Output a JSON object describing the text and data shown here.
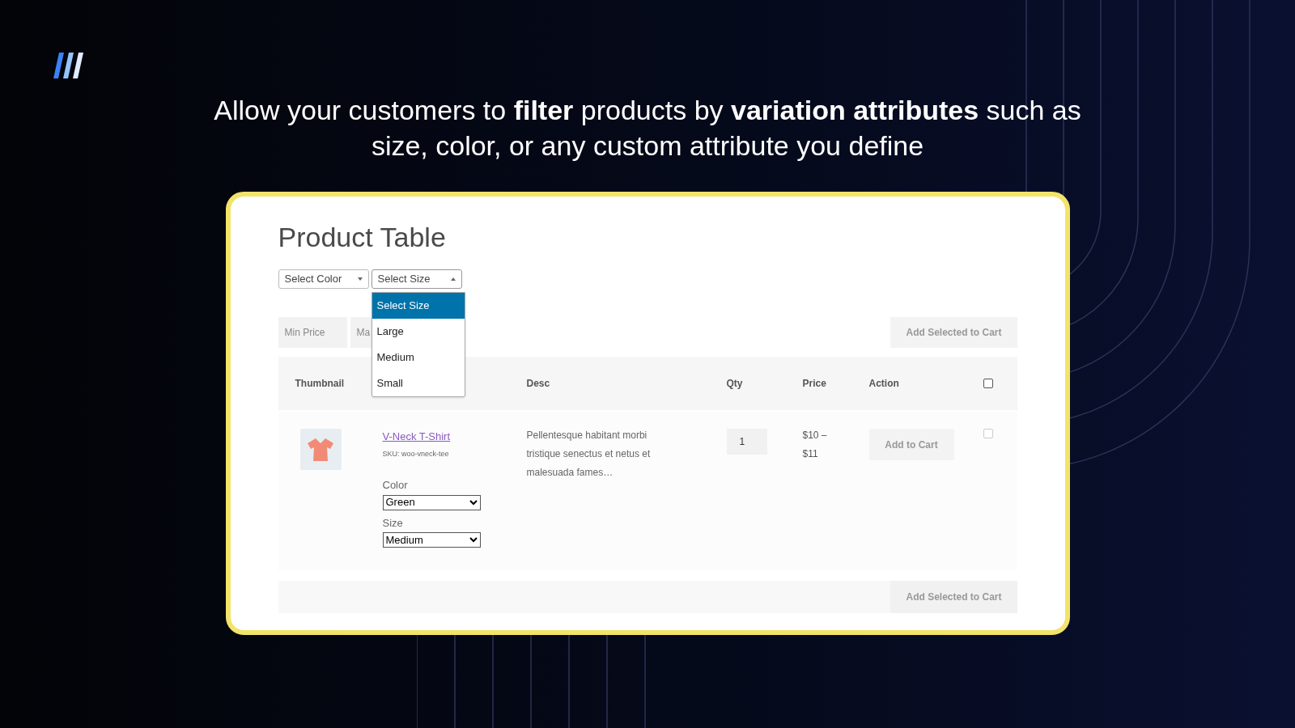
{
  "headline": "Allow your customers to **filter** products by **variation attributes** such as size, color, or any custom attribute you define",
  "page": {
    "title": "Product Table",
    "filters": [
      {
        "placeholder": "Select Color",
        "open": false
      },
      {
        "placeholder": "Select Size",
        "open": true
      }
    ],
    "size_options": [
      {
        "label": "Select Size",
        "selected": true
      },
      {
        "label": "Large",
        "selected": false
      },
      {
        "label": "Medium",
        "selected": false
      },
      {
        "label": "Small",
        "selected": false
      }
    ],
    "price_fields": [
      {
        "placeholder": "Min Price"
      },
      {
        "placeholder": "Ma"
      }
    ],
    "add_selected_top": "Add Selected to Cart",
    "table": {
      "columns": [
        "Thumbnail",
        "Desc",
        "Qty",
        "Price",
        "Action"
      ],
      "select_all_checked": false,
      "rows": [
        {
          "name": "V-Neck T-Shirt",
          "sku": "SKU: woo-vneck-tee",
          "attributes": [
            {
              "label": "Color",
              "value": "Green"
            },
            {
              "label": "Size",
              "value": "Medium"
            }
          ],
          "desc": "Pellentesque habitant morbi tristique senectus et netus et malesuada fames…",
          "qty": "1",
          "price": "$10 – $11",
          "action": "Add to Cart",
          "checked": false
        }
      ]
    },
    "add_selected_bottom": "Add Selected to Cart"
  }
}
